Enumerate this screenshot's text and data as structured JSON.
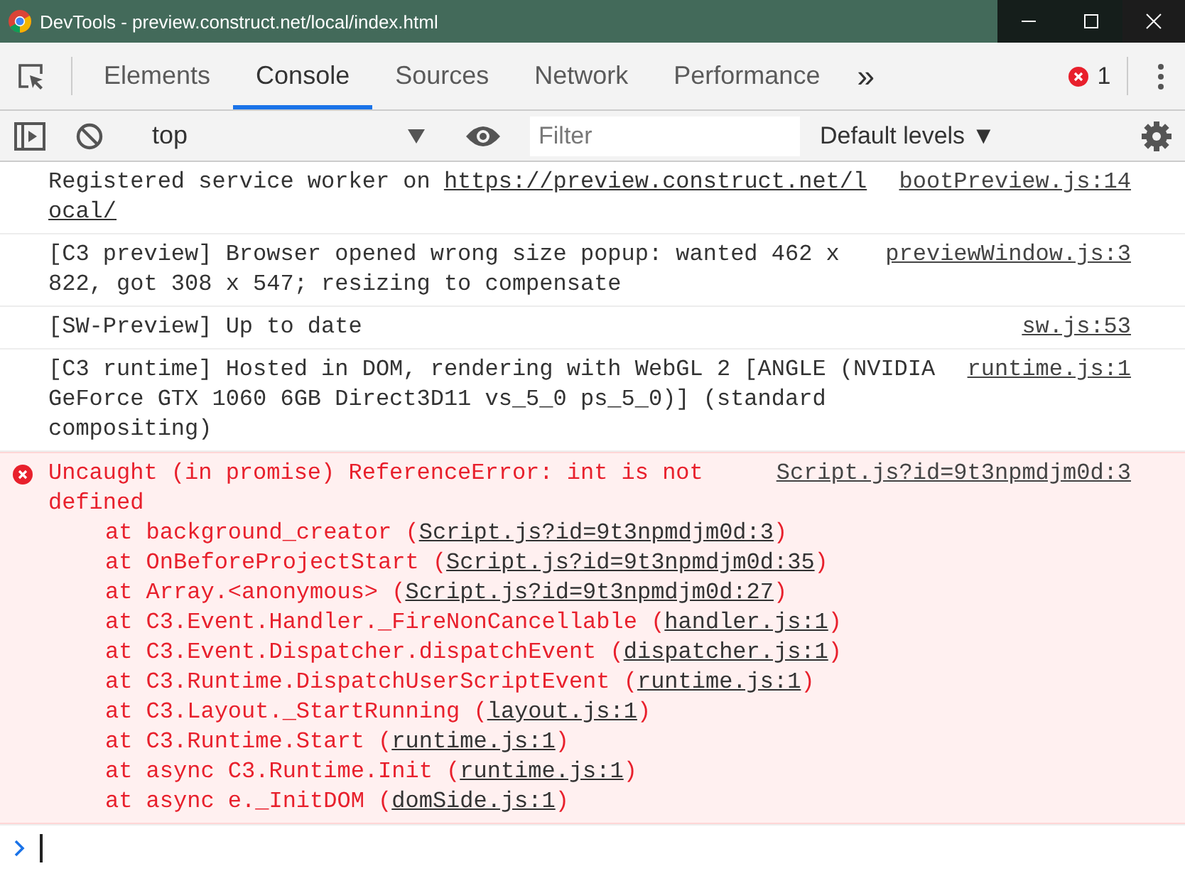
{
  "window": {
    "title": "DevTools - preview.construct.net/local/index.html"
  },
  "tabs": [
    {
      "label": "Elements",
      "selected": false
    },
    {
      "label": "Console",
      "selected": true
    },
    {
      "label": "Sources",
      "selected": false
    },
    {
      "label": "Network",
      "selected": false
    },
    {
      "label": "Performance",
      "selected": false
    }
  ],
  "more_tabs": "»",
  "error_count": "1",
  "toolbar": {
    "context": "top",
    "filter": {
      "placeholder": "Filter"
    },
    "levels": "Default levels ▼"
  },
  "messages": [
    {
      "kind": "log",
      "text": "Registered service worker on ",
      "link": "https://preview.construct.net/local/",
      "source": "bootPreview.js:14"
    },
    {
      "kind": "log",
      "text": "[C3 preview] Browser opened wrong size popup: wanted 462 x 822, got 308 x 547; resizing to compensate",
      "source": "previewWindow.js:3"
    },
    {
      "kind": "log",
      "text": "[SW-Preview] Up to date",
      "source": "sw.js:53"
    },
    {
      "kind": "log",
      "text": "[C3 runtime] Hosted in DOM, rendering with WebGL 2 [ANGLE (NVIDIA GeForce GTX 1060 6GB Direct3D11 vs_5_0 ps_5_0)] (standard compositing)",
      "source": "runtime.js:1"
    },
    {
      "kind": "error",
      "text": "Uncaught (in promise) ReferenceError: int is not defined",
      "source": "Script.js?id=9t3npmdjm0d:3",
      "stack": [
        {
          "call": "at background_creator (",
          "location": "Script.js?id=9t3npmdjm0d:3",
          "end": ")"
        },
        {
          "call": "at OnBeforeProjectStart (",
          "location": "Script.js?id=9t3npmdjm0d:35",
          "end": ")"
        },
        {
          "call": "at Array.<anonymous> (",
          "location": "Script.js?id=9t3npmdjm0d:27",
          "end": ")"
        },
        {
          "call": "at C3.Event.Handler._FireNonCancellable (",
          "location": "handler.js:1",
          "end": ")"
        },
        {
          "call": "at C3.Event.Dispatcher.dispatchEvent (",
          "location": "dispatcher.js:1",
          "end": ")"
        },
        {
          "call": "at C3.Runtime.DispatchUserScriptEvent (",
          "location": "runtime.js:1",
          "end": ")"
        },
        {
          "call": "at C3.Layout._StartRunning (",
          "location": "layout.js:1",
          "end": ")"
        },
        {
          "call": "at C3.Runtime.Start (",
          "location": "runtime.js:1",
          "end": ")"
        },
        {
          "call": "at async C3.Runtime.Init (",
          "location": "runtime.js:1",
          "end": ")"
        },
        {
          "call": "at async e._InitDOM (",
          "location": "domSide.js:1",
          "end": ")"
        }
      ]
    }
  ]
}
